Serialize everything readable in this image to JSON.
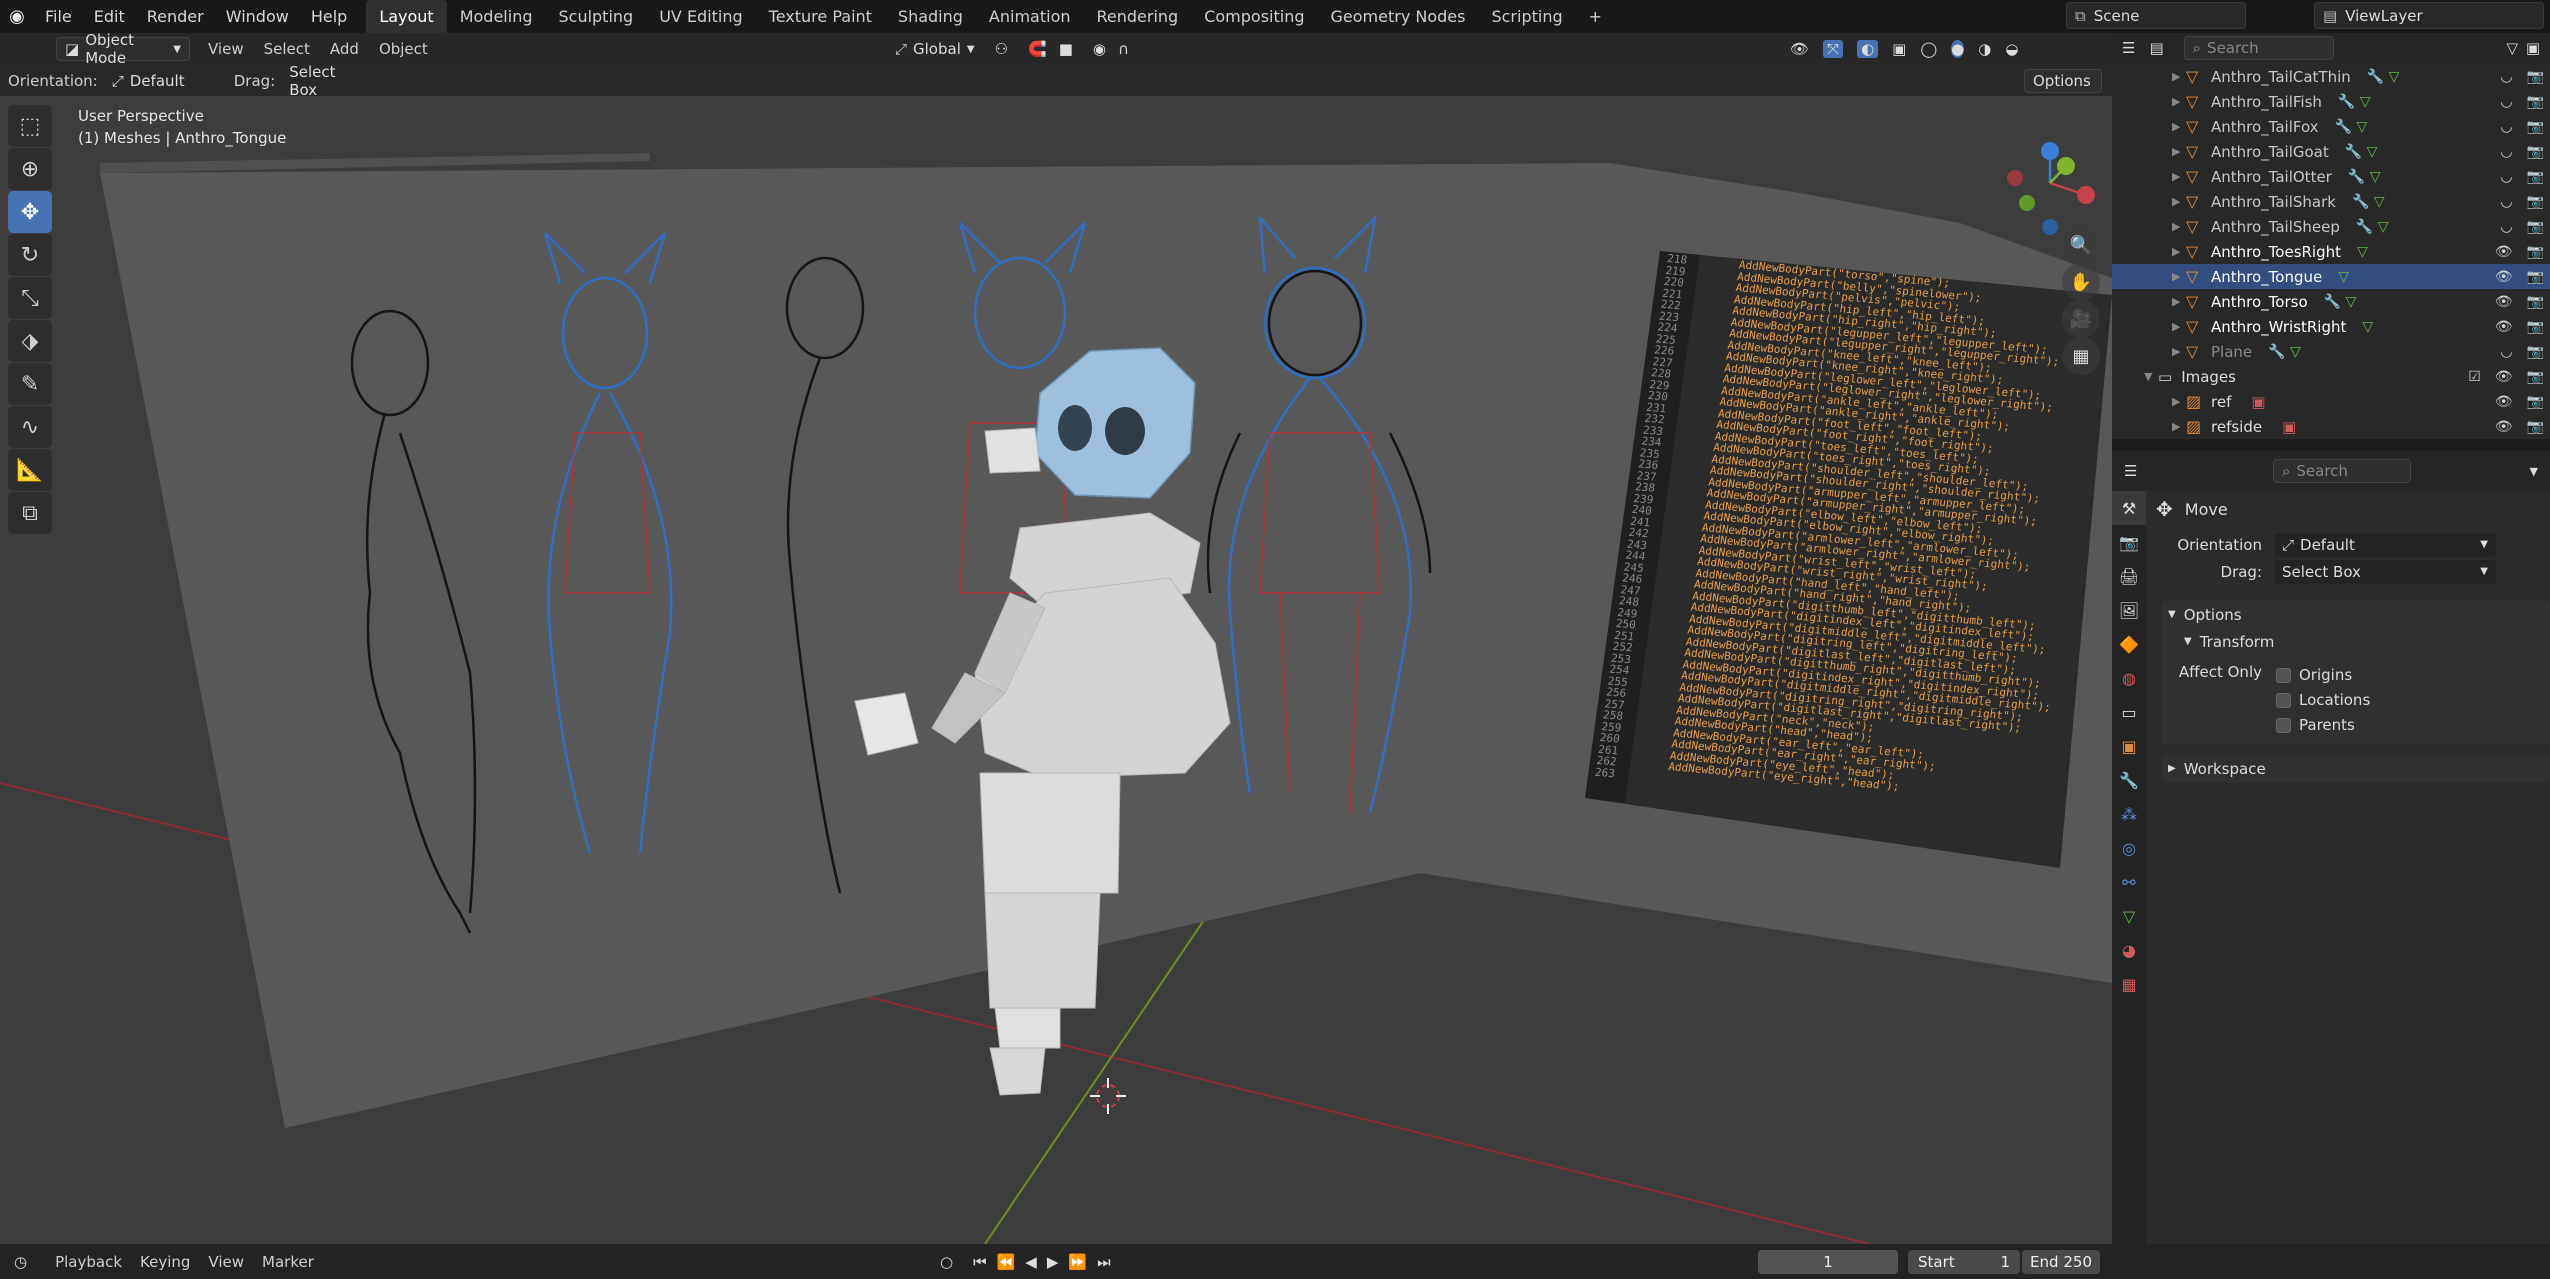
{
  "menu": [
    "File",
    "Edit",
    "Render",
    "Window",
    "Help"
  ],
  "workspaces": [
    "Layout",
    "Modeling",
    "Sculpting",
    "UV Editing",
    "Texture Paint",
    "Shading",
    "Animation",
    "Rendering",
    "Compositing",
    "Geometry Nodes",
    "Scripting"
  ],
  "active_workspace": "Layout",
  "add_workspace": "+",
  "scene": {
    "label": "Scene",
    "view_layer": "ViewLayer"
  },
  "viewport": {
    "mode": "Object Mode",
    "menus": [
      "View",
      "Select",
      "Add",
      "Object"
    ],
    "transform_orientation": "Global",
    "orientation_label": "Orientation:",
    "orientation_value": "Default",
    "drag_label": "Drag:",
    "drag_value": "Select Box",
    "options": "Options",
    "overlay_title": "User Perspective",
    "overlay_sub": "(1) Meshes | Anthro_Tongue",
    "gizmo": {
      "x": "X",
      "y": "Y",
      "z": "Z"
    }
  },
  "outliner": {
    "search_placeholder": "Search",
    "items": [
      {
        "name": "Anthro_TailCatThin",
        "selected": false
      },
      {
        "name": "Anthro_TailFish",
        "selected": false
      },
      {
        "name": "Anthro_TailFox",
        "selected": false
      },
      {
        "name": "Anthro_TailGoat",
        "selected": false
      },
      {
        "name": "Anthro_TailOtter",
        "selected": false
      },
      {
        "name": "Anthro_TailShark",
        "selected": false
      },
      {
        "name": "Anthro_TailSheep",
        "selected": false
      },
      {
        "name": "Anthro_ToesRight",
        "selected": false
      },
      {
        "name": "Anthro_Tongue",
        "selected": true
      },
      {
        "name": "Anthro_Torso",
        "selected": false
      },
      {
        "name": "Anthro_WristRight",
        "selected": false
      },
      {
        "name": "Plane",
        "selected": false
      }
    ],
    "collection": "Images",
    "images": [
      "ref",
      "refside"
    ]
  },
  "properties": {
    "search_placeholder": "Search",
    "tool": "Move",
    "orientation_label": "Orientation",
    "orientation_value": "Default",
    "drag_label": "Drag:",
    "drag_value": "Select Box",
    "options_panel": "Options",
    "transform_panel": "Transform",
    "affect_only": "Affect Only",
    "checkboxes": [
      "Origins",
      "Locations",
      "Parents"
    ],
    "workspace_panel": "Workspace"
  },
  "timeline": {
    "menus": [
      "Playback",
      "Keying",
      "View",
      "Marker"
    ],
    "current_frame": "1",
    "start_label": "Start",
    "start": "1",
    "end_label": "End",
    "end": "250"
  },
  "code_lines": [
    "AddNewBodyPart(\"torso\",\"spine\");",
    "AddNewBodyPart(\"belly\",\"spinelower\");",
    "AddNewBodyPart(\"pelvis\",\"pelvic\");",
    "AddNewBodyPart(\"hip_left\",\"hip_left\");",
    "AddNewBodyPart(\"hip_right\",\"hip_right\");",
    "AddNewBodyPart(\"legupper_left\",\"legupper_left\");",
    "AddNewBodyPart(\"legupper_right\",\"legupper_right\");",
    "AddNewBodyPart(\"knee_left\",\"knee_left\");",
    "AddNewBodyPart(\"knee_right\",\"knee_right\");",
    "AddNewBodyPart(\"leglower_left\",\"leglower_left\");",
    "AddNewBodyPart(\"leglower_right\",\"leglower_right\");",
    "AddNewBodyPart(\"ankle_left\",\"ankle_left\");",
    "AddNewBodyPart(\"ankle_right\",\"ankle_right\");",
    "AddNewBodyPart(\"foot_left\",\"foot_left\");",
    "AddNewBodyPart(\"foot_right\",\"foot_right\");",
    "AddNewBodyPart(\"toes_left\",\"toes_left\");",
    "AddNewBodyPart(\"toes_right\",\"toes_right\");",
    "AddNewBodyPart(\"shoulder_left\",\"shoulder_left\");",
    "AddNewBodyPart(\"shoulder_right\",\"shoulder_right\");",
    "AddNewBodyPart(\"armupper_left\",\"armupper_left\");",
    "AddNewBodyPart(\"armupper_right\",\"armupper_right\");",
    "AddNewBodyPart(\"elbow_left\",\"elbow_left\");",
    "AddNewBodyPart(\"elbow_right\",\"elbow_right\");",
    "AddNewBodyPart(\"armlower_left\",\"armlower_left\");",
    "AddNewBodyPart(\"armlower_right\",\"armlower_right\");",
    "AddNewBodyPart(\"wrist_left\",\"wrist_left\");",
    "AddNewBodyPart(\"wrist_right\",\"wrist_right\");",
    "AddNewBodyPart(\"hand_left\",\"hand_left\");",
    "AddNewBodyPart(\"hand_right\",\"hand_right\");",
    "AddNewBodyPart(\"digitthumb_left\",\"digitthumb_left\");",
    "AddNewBodyPart(\"digitindex_left\",\"digitindex_left\");",
    "AddNewBodyPart(\"digitmiddle_left\",\"digitmiddle_left\");",
    "AddNewBodyPart(\"digitring_left\",\"digitring_left\");",
    "AddNewBodyPart(\"digitlast_left\",\"digitlast_left\");",
    "AddNewBodyPart(\"digitthumb_right\",\"digitthumb_right\");",
    "AddNewBodyPart(\"digitindex_right\",\"digitindex_right\");",
    "AddNewBodyPart(\"digitmiddle_right\",\"digitmiddle_right\");",
    "AddNewBodyPart(\"digitring_right\",\"digitring_right\");",
    "AddNewBodyPart(\"digitlast_right\",\"digitlast_right\");",
    "AddNewBodyPart(\"neck\",\"neck\");",
    "AddNewBodyPart(\"head\",\"head\");",
    "AddNewBodyPart(\"ear_left\",\"ear_left\");",
    "AddNewBodyPart(\"ear_right\",\"ear_right\");",
    "AddNewBodyPart(\"eye_left\",\"head\");",
    "AddNewBodyPart(\"eye_right\",\"head\");"
  ],
  "line_numbers": [
    "218",
    "219",
    "220",
    "221",
    "222",
    "223",
    "224",
    "225",
    "226",
    "227",
    "228",
    "229",
    "230",
    "231",
    "232",
    "233",
    "234",
    "235",
    "236",
    "237",
    "238",
    "239",
    "240",
    "241",
    "242",
    "243",
    "244",
    "245",
    "246",
    "247",
    "248",
    "249",
    "250",
    "251",
    "252",
    "253",
    "254",
    "255",
    "256",
    "257",
    "258",
    "259",
    "260",
    "261",
    "262",
    "263"
  ],
  "colors": {
    "accent": "#4772b3",
    "selected_row": "#334d80",
    "object_icon": "#e08a3e",
    "mesh_icon": "#61b845",
    "x_axis": "#c6414a",
    "y_axis": "#7fb52d",
    "z_axis": "#3a7fd8"
  }
}
